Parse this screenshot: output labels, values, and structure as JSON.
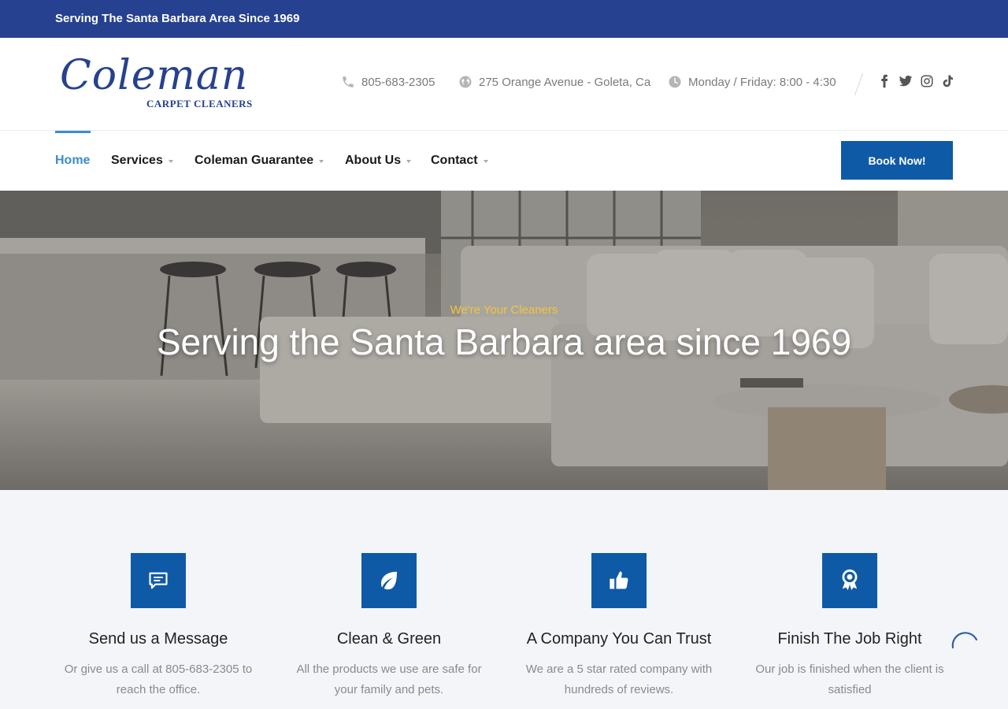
{
  "topbar": {
    "text": "Serving The Santa Barbara Area Since 1969"
  },
  "logo": {
    "script": "Coleman",
    "sub": "CARPET CLEANERS"
  },
  "contact": {
    "phone": "805-683-2305",
    "address": "275 Orange Avenue - Goleta, Ca",
    "hours": "Monday / Friday: 8:00 - 4:30"
  },
  "socials": [
    "facebook-icon",
    "twitter-icon",
    "instagram-icon",
    "tiktok-icon"
  ],
  "nav": {
    "home": "Home",
    "services": "Services",
    "guarantee": "Coleman Guarantee",
    "about": "About Us",
    "contact": "Contact",
    "book": "Book Now!"
  },
  "hero": {
    "kicker": "We're Your Cleaners",
    "title": "Serving the Santa Barbara area since 1969"
  },
  "features": [
    {
      "icon": "message-icon",
      "title": "Send us a Message",
      "text": "Or give us a call at 805-683-2305 to reach the office."
    },
    {
      "icon": "leaf-icon",
      "title": "Clean & Green",
      "text": "All the products we use are safe for your family and pets."
    },
    {
      "icon": "thumbs-up-icon",
      "title": "A Company You Can Trust",
      "text": "We are a 5 star rated company with hundreds of reviews."
    },
    {
      "icon": "award-icon",
      "title": "Finish The Job Right",
      "text": "Our job is finished when the client is satisfied"
    }
  ],
  "colors": {
    "brand": "#26418f",
    "accent": "#0f5aa6",
    "active": "#3c8dc9",
    "kicker": "#f3c53a"
  }
}
